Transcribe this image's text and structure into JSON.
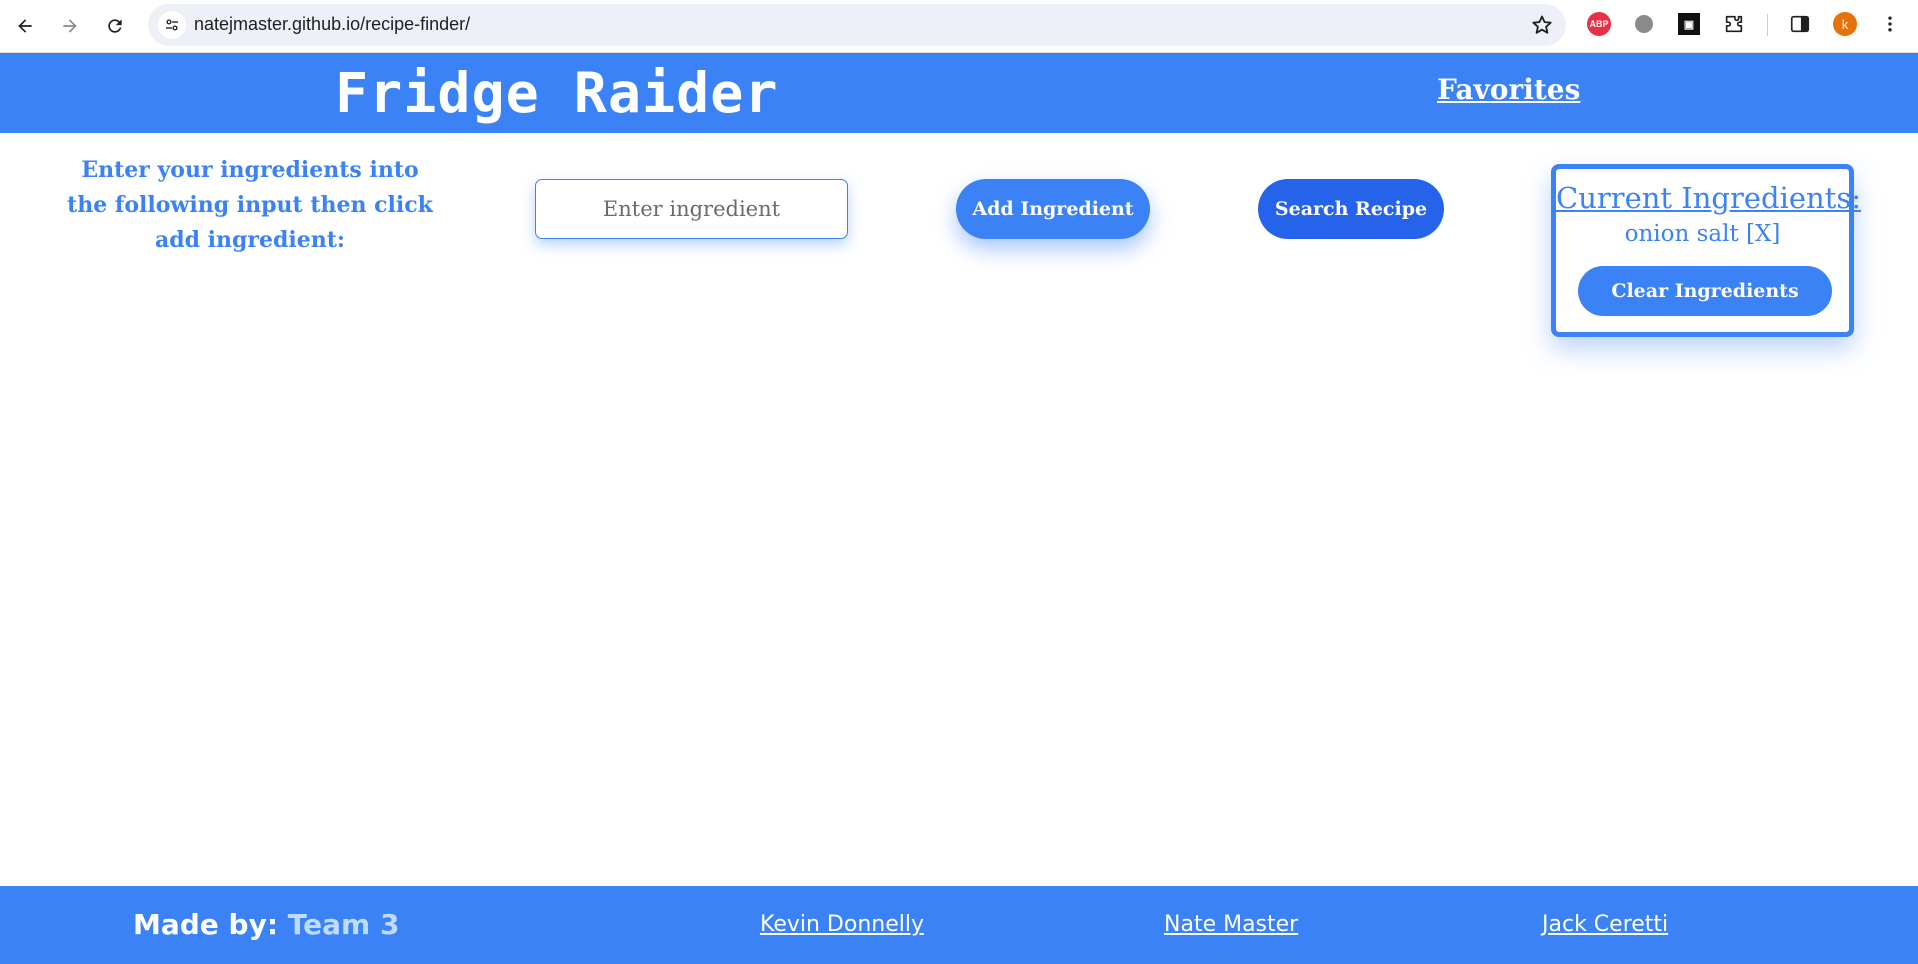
{
  "browser": {
    "url": "natejmaster.github.io/recipe-finder/",
    "profile_initial": "k",
    "extensions": [
      "adblock-plus-icon",
      "ghostery-icon",
      "extension-square-icon",
      "puzzle-icon"
    ],
    "extension_abp_label": "ABP"
  },
  "header": {
    "title": "Fridge Raider",
    "favorites_label": "Favorites"
  },
  "main": {
    "instructions": "Enter your ingredients into the following input then click add ingredient:",
    "input_placeholder": "Enter ingredient",
    "add_button_label": "Add Ingredient",
    "search_button_label": "Search Recipe"
  },
  "current_ingredients": {
    "title": "Current Ingredients:",
    "items": [
      {
        "label": "onion salt [X]"
      }
    ],
    "clear_button_label": "Clear Ingredients"
  },
  "footer": {
    "made_by_label": "Made by:",
    "team_name": "Team 3",
    "members": [
      {
        "name": "Kevin Donnelly"
      },
      {
        "name": "Nate Master"
      },
      {
        "name": "Jack Ceretti"
      }
    ]
  },
  "colors": {
    "primary": "#3b82f6",
    "primary_dark": "#2563eb",
    "team_text": "#bfdbfe"
  }
}
